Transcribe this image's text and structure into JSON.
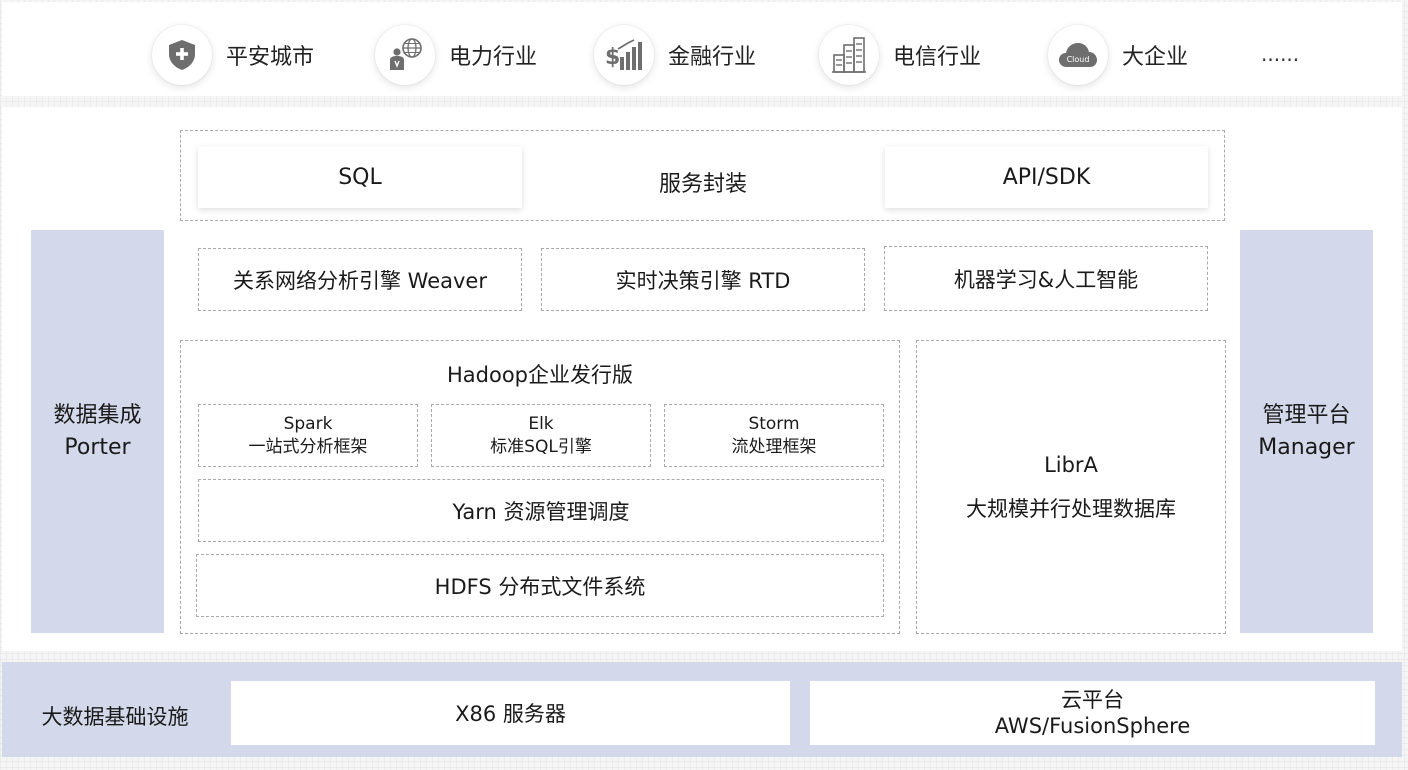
{
  "industries": [
    {
      "icon": "shield-plus-icon",
      "label": "平安城市"
    },
    {
      "icon": "power-globe-icon",
      "label": "电力行业"
    },
    {
      "icon": "finance-bars-icon",
      "label": "金融行业"
    },
    {
      "icon": "telecom-building-icon",
      "label": "电信行业"
    },
    {
      "icon": "cloud-icon",
      "label": "大企业",
      "icon_text": "Cloud"
    }
  ],
  "industries_more": "......",
  "service": {
    "sql": "SQL",
    "center": "服务封装",
    "api": "API/SDK"
  },
  "engines": {
    "weaver": "关系网络分析引擎 Weaver",
    "rtd": "实时决策引擎  RTD",
    "ml": "机器学习&人工智能"
  },
  "hadoop": {
    "title": "Hadoop企业发行版",
    "spark": {
      "name": "Spark",
      "desc": "一站式分析框架"
    },
    "elk": {
      "name": "Elk",
      "desc": "标准SQL引擎"
    },
    "storm": {
      "name": "Storm",
      "desc": "流处理框架"
    },
    "yarn": "Yarn 资源管理调度",
    "hdfs": "HDFS 分布式文件系统"
  },
  "libra": {
    "name": "LibrA",
    "desc": "大规模并行处理数据库"
  },
  "left_sidebar": {
    "line1": "数据集成",
    "line2": "Porter"
  },
  "right_sidebar": {
    "line1": "管理平台",
    "line2": "Manager"
  },
  "infrastructure": {
    "label": "大数据基础设施",
    "x86": "X86 服务器",
    "cloud_line1": "云平台",
    "cloud_line2": "AWS/FusionSphere"
  },
  "colors": {
    "lavender": "#d3d9ea",
    "icon_gray": "#6e6e6e",
    "dash": "#a9a9a9"
  }
}
